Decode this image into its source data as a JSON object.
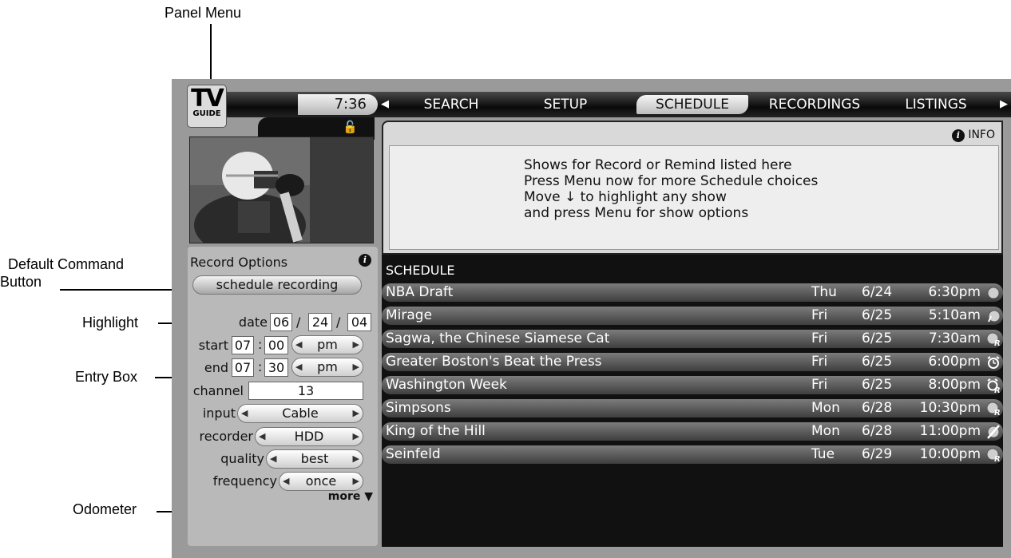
{
  "callouts": {
    "panel_menu": "Panel Menu",
    "default_command": "Default Command",
    "default_command_2": "Button",
    "highlight": "Highlight",
    "entry_box": "Entry Box",
    "odometer": "Odometer"
  },
  "logo": {
    "line1": "TV",
    "line2": "GUIDE"
  },
  "clock": "7:36",
  "nav": {
    "left_arrow": "◀",
    "right_arrow": "▶",
    "tabs": [
      "SEARCH",
      "SETUP",
      "SCHEDULE",
      "RECORDINGS",
      "LISTINGS"
    ],
    "active": "SCHEDULE"
  },
  "info": {
    "button_label": "INFO",
    "message": [
      "Shows for Record or Remind listed here",
      "Press Menu now for more Schedule choices",
      "Move ↓ to highlight any show",
      "and press Menu for show options"
    ]
  },
  "record_options": {
    "title": "Record Options",
    "default_button": "schedule recording",
    "date": {
      "label": "date",
      "month": "06",
      "day": "24",
      "year": "04",
      "sep": "/"
    },
    "start": {
      "label": "start",
      "hour": "07",
      "minute": "00",
      "ampm": "pm",
      "sep": ":"
    },
    "end": {
      "label": "end",
      "hour": "07",
      "minute": "30",
      "ampm": "pm",
      "sep": ":"
    },
    "channel": {
      "label": "channel",
      "value": "13"
    },
    "input": {
      "label": "input",
      "value": "Cable"
    },
    "recorder": {
      "label": "recorder",
      "value": "HDD"
    },
    "quality": {
      "label": "quality",
      "value": "best"
    },
    "frequency": {
      "label": "frequency",
      "value": "once"
    },
    "more": "more ▼"
  },
  "schedule": {
    "title": "SCHEDULE",
    "rows": [
      {
        "show": "NBA Draft",
        "day": "Thu",
        "date": "6/24",
        "time": "6:30pm",
        "status": "record-dot"
      },
      {
        "show": "Mirage",
        "day": "Fri",
        "date": "6/25",
        "time": "5:10am",
        "status": "record-partial"
      },
      {
        "show": "Sagwa, the Chinese Siamese Cat",
        "day": "Fri",
        "date": "6/25",
        "time": "7:30am",
        "status": "record-repeat"
      },
      {
        "show": "Greater Boston's Beat the Press",
        "day": "Fri",
        "date": "6/25",
        "time": "6:00pm",
        "status": "remind"
      },
      {
        "show": "Washington Week",
        "day": "Fri",
        "date": "6/25",
        "time": "8:00pm",
        "status": "remind-repeat"
      },
      {
        "show": "Simpsons",
        "day": "Mon",
        "date": "6/28",
        "time": "10:30pm",
        "status": "record-repeat"
      },
      {
        "show": "King of the Hill",
        "day": "Mon",
        "date": "6/28",
        "time": "11:00pm",
        "status": "cancelled"
      },
      {
        "show": "Seinfeld",
        "day": "Tue",
        "date": "6/29",
        "time": "10:00pm",
        "status": "record-repeat"
      }
    ]
  }
}
